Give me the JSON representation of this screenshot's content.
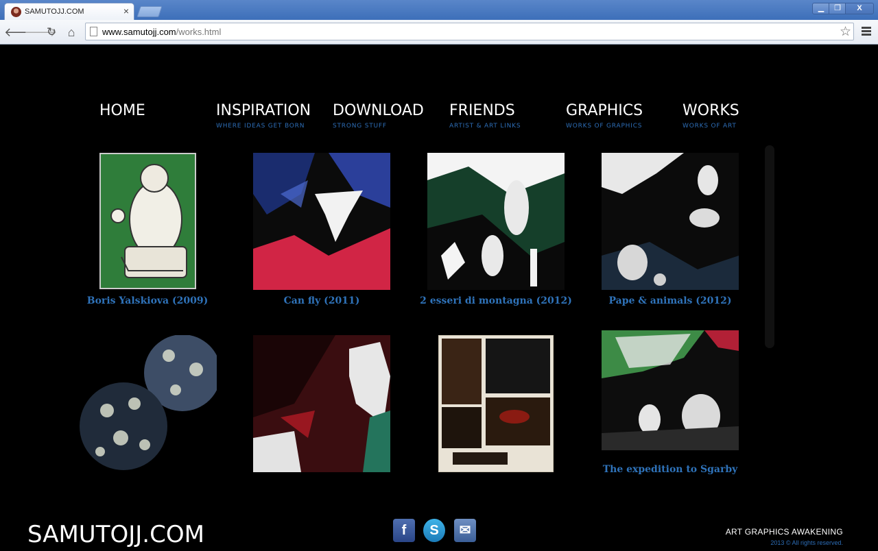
{
  "browser": {
    "tab_title": "SAMUTOJJ.COM",
    "tab_close": "×",
    "url_domain": "www.samutojj.com",
    "url_path": "/works.html",
    "window_controls": {
      "minimize": "▁",
      "maximize": "❐",
      "close": "X"
    }
  },
  "nav": [
    {
      "label": "HOME",
      "sub": ""
    },
    {
      "label": "INSPIRATION",
      "sub": "WHERE IDEAS GET BORN"
    },
    {
      "label": "DOWNLOAD",
      "sub": "STRONG STUFF"
    },
    {
      "label": "FRIENDS",
      "sub": "ARTIST & ART LINKS"
    },
    {
      "label": "GRAPHICS",
      "sub": "WORKS OF GRAPHICS"
    },
    {
      "label": "WORKS",
      "sub": "WORKS OF ART"
    }
  ],
  "works": [
    {
      "caption": "Boris Yalskiova (2009)",
      "palette": [
        "#2f7d3a",
        "#f0eee6",
        "#3a3a3a"
      ]
    },
    {
      "caption": "Can fly (2011)",
      "palette": [
        "#1a2c6e",
        "#e7284b",
        "#0b0b0b"
      ]
    },
    {
      "caption": "2 esseri di montagna (2012)",
      "palette": [
        "#153f2a",
        "#f4f4f4",
        "#0a0a0a"
      ]
    },
    {
      "caption": "Pape & animals (2012)",
      "palette": [
        "#0b0b0b",
        "#1b2a3b",
        "#eaeaea"
      ]
    },
    {
      "caption": "",
      "palette": [
        "#202b3a",
        "#d8dccb",
        "#3d4d66"
      ]
    },
    {
      "caption": "",
      "palette": [
        "#3a0d10",
        "#e7e7e7",
        "#24745c"
      ]
    },
    {
      "caption": "",
      "palette": [
        "#e9e3d6",
        "#3a2415",
        "#8a1b12"
      ]
    },
    {
      "caption": "The expedition to Sgarby",
      "palette": [
        "#0d0d0d",
        "#e5e5e5",
        "#3d8b46"
      ]
    }
  ],
  "footer": {
    "logo": "SAMUTOJJ.COM",
    "tagline": "ART GRAPHICS AWAKENING",
    "copyright": "2013 © All rights reserved.",
    "social": [
      {
        "icon": "facebook-icon",
        "glyph": "f"
      },
      {
        "icon": "skype-icon",
        "glyph": "S"
      },
      {
        "icon": "mail-icon",
        "glyph": "✉"
      }
    ]
  }
}
